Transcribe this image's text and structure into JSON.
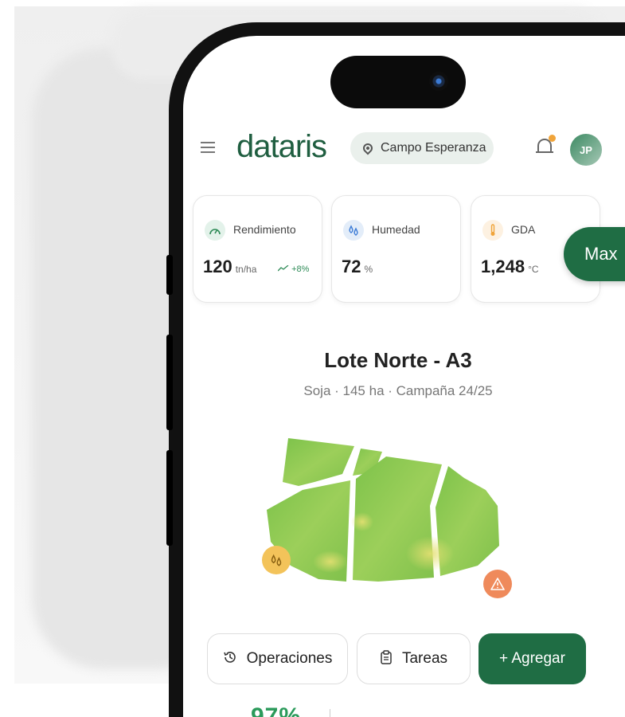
{
  "app": {
    "logo": "dataris"
  },
  "header": {
    "location": "Campo Esperanza",
    "avatar_initials": "JP"
  },
  "stats": [
    {
      "label": "Rendimiento",
      "value": "120",
      "unit": "tn/ha",
      "trend": "+8%",
      "icon": "speedometer-icon",
      "icon_color": "#2e8b57"
    },
    {
      "label": "Humedad",
      "value": "72",
      "unit": "%",
      "icon": "droplets-icon",
      "icon_color": "#3b7bd6"
    },
    {
      "label": "GDA",
      "value": "1,248",
      "unit": "°C",
      "icon": "thermometer-icon",
      "icon_color": "#f0a43a"
    }
  ],
  "floating_button": {
    "label": "Max"
  },
  "lot": {
    "title": "Lote Norte - A3",
    "subtitle": "Soja · 145 ha · Campaña 24/25"
  },
  "actions": {
    "operations": "Operaciones",
    "tasks": "Tareas",
    "add": "+ Agregar"
  },
  "bottom_peek": {
    "value": "97%"
  },
  "colors": {
    "brand": "#1f6d44",
    "accent_green": "#2e8b57",
    "warning": "#ef8a5b",
    "water": "#f3c35a"
  }
}
